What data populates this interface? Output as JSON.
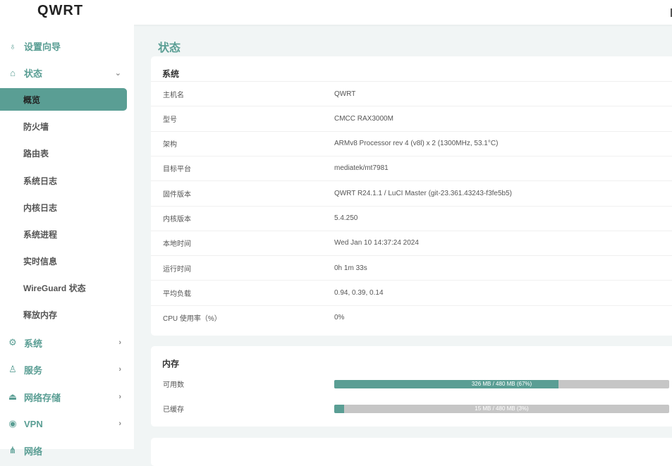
{
  "header": {
    "logo": "QWRT"
  },
  "sidebar": {
    "items": [
      {
        "label": "设置向导",
        "icon": "lightbulb-icon",
        "chev": ""
      },
      {
        "label": "状态",
        "icon": "home-icon",
        "chev": "⌄"
      }
    ],
    "sub": [
      "概览",
      "防火墙",
      "路由表",
      "系统日志",
      "内核日志",
      "系统进程",
      "实时信息",
      "WireGuard 状态",
      "释放内存"
    ],
    "groups": [
      {
        "label": "系统",
        "icon": "gear-icon"
      },
      {
        "label": "服务",
        "icon": "user-icon"
      },
      {
        "label": "网络存储",
        "icon": "drive-icon"
      },
      {
        "label": "VPN",
        "icon": "globe-icon"
      },
      {
        "label": "网络",
        "icon": "network-icon"
      }
    ]
  },
  "page": {
    "title": "状态"
  },
  "system": {
    "title": "系统",
    "rows": [
      {
        "k": "主机名",
        "v": "QWRT"
      },
      {
        "k": "型号",
        "v": "CMCC RAX3000M"
      },
      {
        "k": "架构",
        "v": "ARMv8 Processor rev 4 (v8l) x 2 (1300MHz, 53.1°C)"
      },
      {
        "k": "目标平台",
        "v": "mediatek/mt7981"
      },
      {
        "k": "固件版本",
        "v": "QWRT R24.1.1 / LuCI Master (git-23.361.43243-f3fe5b5)"
      },
      {
        "k": "内核版本",
        "v": "5.4.250"
      },
      {
        "k": "本地时间",
        "v": "Wed Jan 10 14:37:24 2024"
      },
      {
        "k": "运行时间",
        "v": "0h 1m 33s"
      },
      {
        "k": "平均负载",
        "v": "0.94, 0.39, 0.14"
      },
      {
        "k": "CPU 使用率（%）",
        "v": "0%"
      }
    ]
  },
  "memory": {
    "title": "内存",
    "rows": [
      {
        "k": "可用数",
        "text": "326 MB / 480 MB (67%)",
        "percent": 67
      },
      {
        "k": "已缓存",
        "text": "15 MB / 480 MB (3%)",
        "percent": 3
      }
    ]
  },
  "colors": {
    "accent": "#5a9e94"
  }
}
